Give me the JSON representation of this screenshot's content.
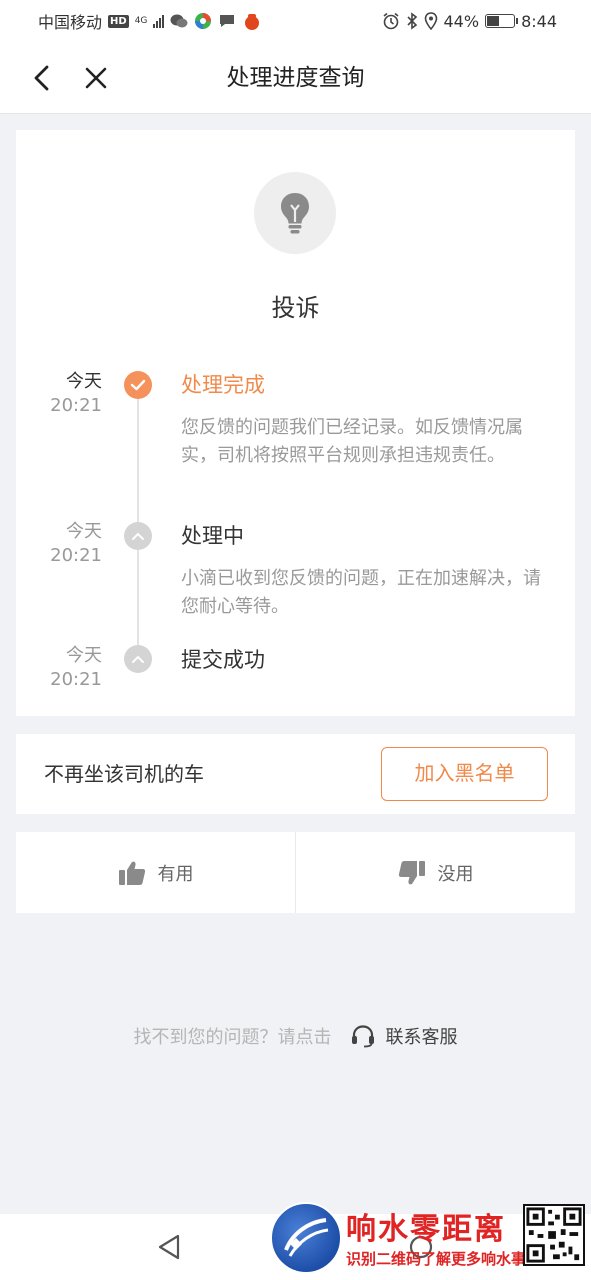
{
  "status_bar": {
    "carrier": "中国移动",
    "hd": "HD",
    "network": "4G",
    "battery": "44%",
    "battery_level": 0.44,
    "time": "8:44"
  },
  "header": {
    "title": "处理进度查询"
  },
  "complaint": {
    "icon": "lightbulb-icon",
    "title": "投诉",
    "timeline": [
      {
        "day": "今天",
        "time": "20:21",
        "title": "处理完成",
        "status": "done",
        "desc": "您反馈的问题我们已经记录。如反馈情况属实，司机将按照平台规则承担违规责任。"
      },
      {
        "day": "今天",
        "time": "20:21",
        "title": "处理中",
        "status": "pending",
        "desc": "小滴已收到您反馈的问题，正在加速解决，请您耐心等待。"
      },
      {
        "day": "今天",
        "time": "20:21",
        "title": "提交成功",
        "status": "pending",
        "desc": ""
      }
    ]
  },
  "blacklist": {
    "text": "不再坐该司机的车",
    "button": "加入黑名单"
  },
  "feedback": {
    "useful": "有用",
    "useless": "没用"
  },
  "help": {
    "question": "找不到您的问题？请点击",
    "contact": "联系客服"
  },
  "watermark": {
    "title": "响水零距离",
    "subtitle": "识别二维码了解更多响水事"
  },
  "colors": {
    "accent": "#f08a4b",
    "background": "#f0f2f5"
  }
}
